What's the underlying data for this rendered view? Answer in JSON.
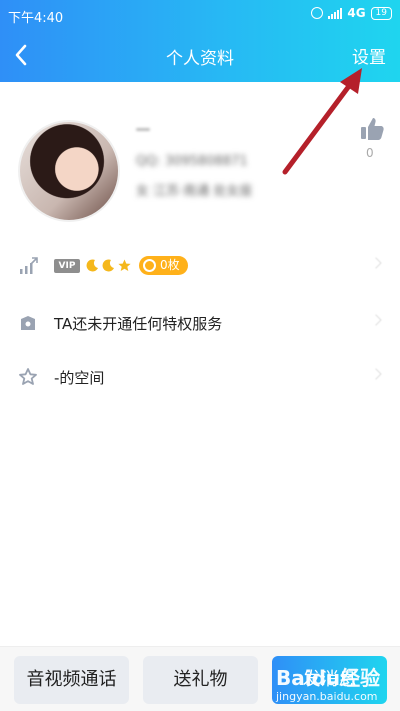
{
  "status_bar": {
    "time": "下午4:40",
    "network": "4G",
    "battery": "19"
  },
  "title_bar": {
    "back_icon": "chevron-left-icon",
    "title": "个人资料",
    "settings_label": "设置"
  },
  "profile": {
    "nickname": "—",
    "qq_line": "QQ: 3095808871",
    "info_line": "女 江苏·南通 处女座",
    "like_count": "0"
  },
  "rows": {
    "level": {
      "vip": "VIP",
      "coins": "0枚"
    },
    "privilege": {
      "label": "TA还未开通任何特权服务"
    },
    "space": {
      "label": "-的空间"
    }
  },
  "bottom": {
    "call": "音视频通话",
    "gift": "送礼物",
    "message": "发消息"
  },
  "watermark": {
    "brand": "Baidu经验",
    "url": "jingyan.baidu.com"
  },
  "colors": {
    "header_start": "#2f8ff7",
    "header_end": "#1fd5ef",
    "coin": "#ffb11a",
    "arrow": "#b5202a"
  }
}
